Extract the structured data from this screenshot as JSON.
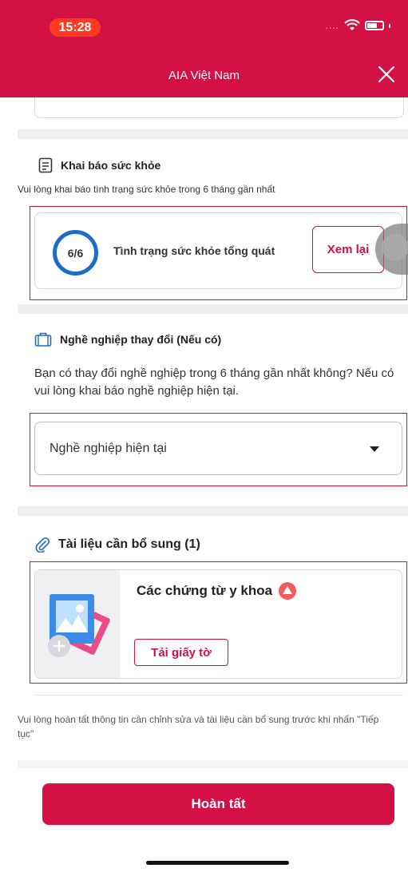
{
  "status_bar": {
    "time": "15:28",
    "signal": "....",
    "icons": [
      "wifi-icon",
      "battery-icon"
    ]
  },
  "header": {
    "title": "AIA Việt Nam",
    "close_icon": "close-icon"
  },
  "health": {
    "heading": "Khai báo sức khỏe",
    "description": "Vui lòng khai báo tình trạng sức khỏe trong 6 tháng gần nhất",
    "progress": "6/6",
    "progress_fraction": 1.0,
    "item_label": "Tình trạng sức khỏe tổng quát",
    "review_button": "Xem lại"
  },
  "occupation": {
    "heading": "Nghề nghiệp thay đổi (Nếu có)",
    "description": "Bạn có thay đổi nghề nghiệp trong 6 tháng gần nhất không? Nếu có vui lòng khai báo nghề nghiệp hiện tại.",
    "select_placeholder": "Nghề nghiệp hiện tại"
  },
  "documents": {
    "heading": "Tài liệu cần bổ sung (1)",
    "item_title": "Các chứng từ y khoa",
    "upload_button": "Tải giấy tờ"
  },
  "note": "Vui lòng hoàn tất thông tin cần chỉnh sửa và tài liệu cần bổ sung trước khi nhấn \"Tiếp tục\"",
  "finish_button": "Hoàn tất",
  "colors": {
    "brand": "#d31145",
    "progress_ring": "#1f6cc6",
    "status_pill": "#ff3b1f"
  }
}
